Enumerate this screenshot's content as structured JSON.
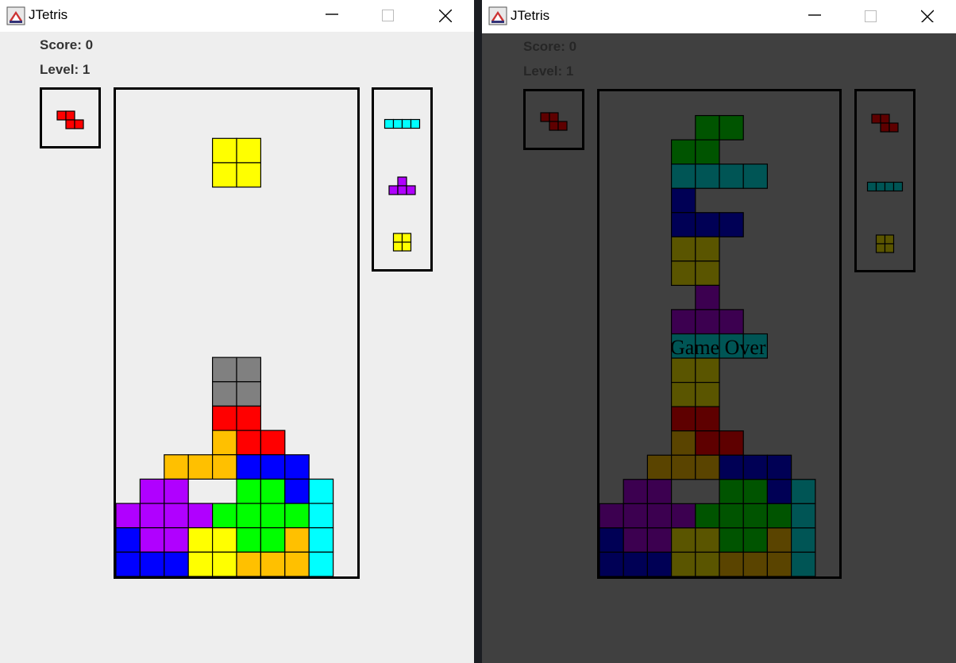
{
  "windows": [
    {
      "id": "left",
      "title": "JTetris",
      "score_label": "Score:",
      "score": "0",
      "level_label": "Level:",
      "level": "1",
      "game_over_text": "",
      "hold": [
        "Z"
      ],
      "next": [
        "I",
        "T",
        "O"
      ]
    },
    {
      "id": "right",
      "title": "JTetris",
      "score_label": "Score:",
      "score": "0",
      "level_label": "Level:",
      "level": "1",
      "game_over_text": "Game Over",
      "hold": [
        "Z"
      ],
      "next": [
        "Z",
        "I",
        "O"
      ]
    }
  ],
  "piece_colors": {
    "Y": "#ffff00",
    "R": "#ff0000",
    "O": "#ffc000",
    "B": "#0000ff",
    "P": "#b000ff",
    "G": "#00ff00",
    "C": "#00ffff",
    "X": "#808080"
  },
  "dim_colors": {
    "Y": "#5a5500",
    "R": "#5e0000",
    "O": "#5a4400",
    "B": "#000055",
    "P": "#3c0050",
    "G": "#005400",
    "C": "#005555",
    "X": "#444444"
  },
  "board_left": [
    "..........",
    "..........",
    "..........",
    "....YY....",
    "....YY....",
    "..........",
    "..........",
    "..........",
    "..........",
    "..........",
    "..........",
    "..........",
    "....XX....",
    "....XX....",
    "....RR....",
    "....ORR...",
    "..OOOBBB..",
    ".PP..GGBC.",
    "PPPPGGGGC.",
    "BPPYYGGOC.",
    "BBBYYOOOC."
  ],
  "board_right": [
    "..........",
    "..........",
    "....GG....",
    "...GG.....",
    "...CCCC...",
    "...B......",
    "...BBB....",
    "...YY.....",
    "...YY.....",
    "....P.....",
    "...PPP....",
    "...CCCC...",
    "...YY.....",
    "...YY.....",
    "...RR.....",
    "...ORR....",
    "..OOOBBB..",
    ".PP..GGBC.",
    "PPPPGGGGC.",
    "BPPYYGGOC.",
    "BBBYYOOOC."
  ]
}
